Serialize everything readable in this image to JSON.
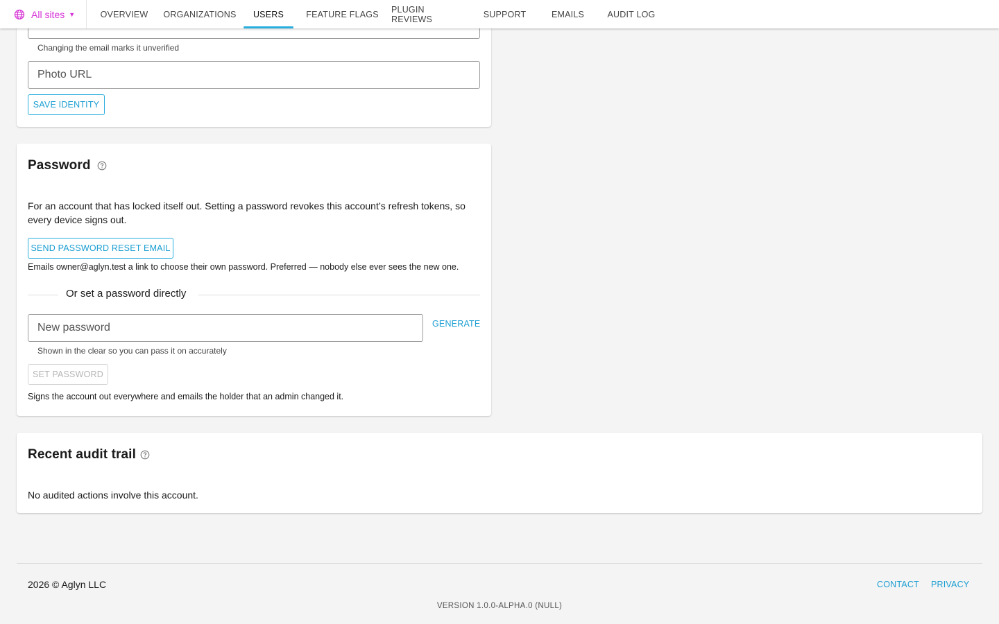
{
  "nav": {
    "site_picker": "All sites",
    "tabs": [
      {
        "label": "OVERVIEW"
      },
      {
        "label": "ORGANIZATIONS"
      },
      {
        "label": "USERS"
      },
      {
        "label": "FEATURE FLAGS"
      },
      {
        "label": "PLUGIN REVIEWS"
      },
      {
        "label": "SUPPORT"
      },
      {
        "label": "EMAILS"
      },
      {
        "label": "AUDIT LOG"
      }
    ],
    "active_tab": "USERS"
  },
  "identity": {
    "email_hint": "Changing the email marks it unverified",
    "photo_url_placeholder": "Photo URL",
    "save_label": "SAVE IDENTITY"
  },
  "password": {
    "title": "Password",
    "description": "For an account that has locked itself out. Setting a password revokes this account’s refresh tokens, so every device signs out.",
    "reset_button": "SEND PASSWORD RESET EMAIL",
    "reset_note": "Emails owner@aglyn.test a link to choose their own password. Preferred — nobody else ever sees the new one.",
    "divider_label": "Or set a password directly",
    "new_password_placeholder": "New password",
    "generate_label": "GENERATE",
    "new_password_hint": "Shown in the clear so you can pass it on accurately",
    "set_button": "SET PASSWORD",
    "set_note": "Signs the account out everywhere and emails the holder that an admin changed it."
  },
  "audit": {
    "title": "Recent audit trail",
    "empty_text": "No audited actions involve this account."
  },
  "footer": {
    "copyright": "2026 © Aglyn LLC",
    "contact": "CONTACT",
    "privacy": "PRIVACY",
    "version": "VERSION 1.0.0-ALPHA.0 (NULL)"
  },
  "colors": {
    "accent": "#29aede",
    "site_picker": "#d633d6",
    "background": "#f4f4f4"
  }
}
